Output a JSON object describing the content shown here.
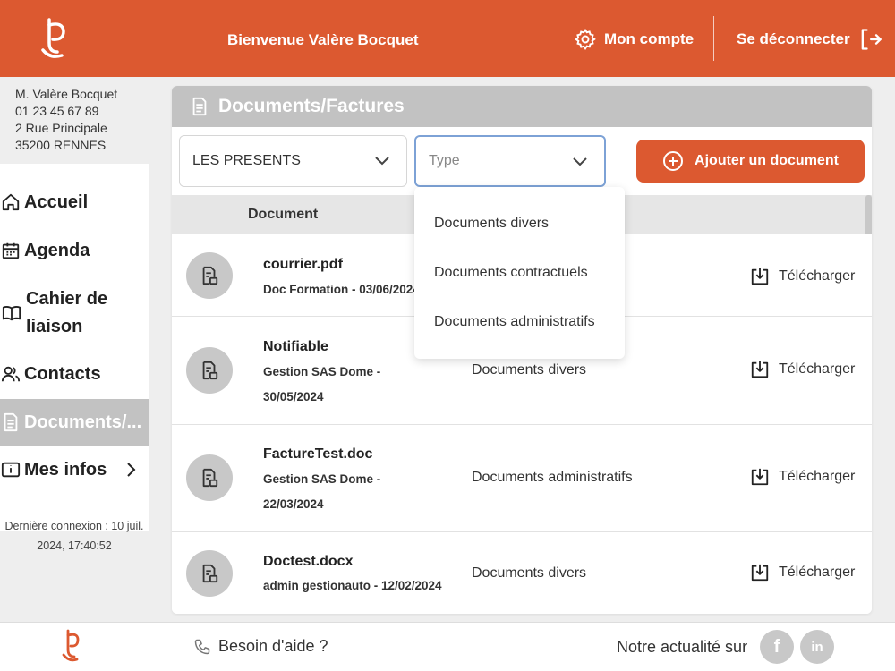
{
  "header": {
    "welcome": "Bienvenue Valère Bocquet",
    "account_label": "Mon compte",
    "logout_label": "Se déconnecter",
    "brand_color": "#dc5930"
  },
  "sidebar": {
    "address": [
      "M. Valère Bocquet",
      "01 23 45 67 89",
      "2 Rue Principale",
      "35200 RENNES"
    ],
    "items": [
      {
        "label": "Accueil",
        "icon": "home-icon"
      },
      {
        "label": "Agenda",
        "icon": "calendar-icon"
      },
      {
        "label": "Cahier de liaison",
        "line1": "Cahier de",
        "line2": "liaison",
        "icon": "book-icon"
      },
      {
        "label": "Contacts",
        "icon": "contacts-icon"
      },
      {
        "label": "Documents/...",
        "icon": "document-icon",
        "active": true
      },
      {
        "label": "Mes infos",
        "icon": "info-icon"
      }
    ],
    "last_login_line1": "Dernière connexion : 10 juil.",
    "last_login_line2": "2024, 17:40:52"
  },
  "main": {
    "title": "Documents/Factures",
    "filter_value": "LES PRESENTS",
    "type_placeholder": "Type",
    "add_button": "Ajouter un document",
    "column_document": "Document",
    "type_options": [
      "Documents divers",
      "Documents contractuels",
      "Documents administratifs"
    ],
    "rows": [
      {
        "name": "courrier.pdf",
        "meta": "Doc Formation - 03/06/2024",
        "type": "",
        "download": "Télécharger"
      },
      {
        "name": "Notifiable",
        "meta_line1": "Gestion SAS Dome -",
        "meta_line2": "30/05/2024",
        "type": "Documents divers",
        "download": "Télécharger"
      },
      {
        "name": "FactureTest.doc",
        "meta_line1": "Gestion SAS Dome -",
        "meta_line2": "22/03/2024",
        "type": "Documents administratifs",
        "download": "Télécharger"
      },
      {
        "name": "Doctest.docx",
        "meta": "admin gestionauto - 12/02/2024",
        "type": "Documents divers",
        "download": "Télécharger"
      }
    ]
  },
  "footer": {
    "help": "Besoin d'aide ?",
    "news": "Notre actualité sur",
    "social": [
      "f",
      "in"
    ]
  }
}
